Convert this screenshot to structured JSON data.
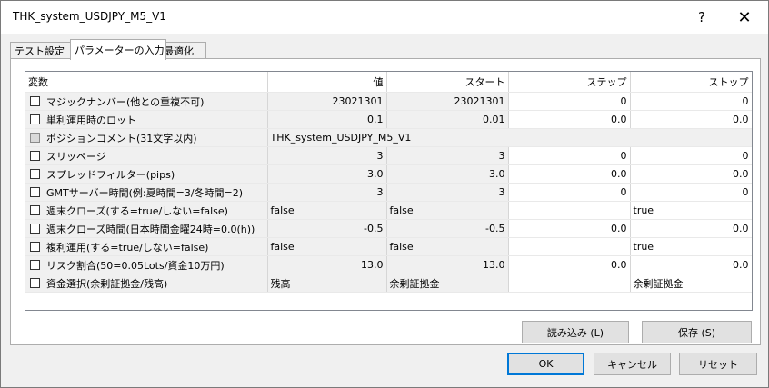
{
  "window": {
    "title": "THK_system_USDJPY_M5_V1",
    "help": "?",
    "close": "✕"
  },
  "tabs": [
    {
      "label": "テスト設定"
    },
    {
      "label": "パラメーターの入力"
    },
    {
      "label": "最適化"
    }
  ],
  "grid": {
    "headers": {
      "name": "変数",
      "value": "値",
      "start": "スタート",
      "step": "ステップ",
      "stop": "ストップ"
    },
    "rows": [
      {
        "name": "マジックナンバー(他との重複不可)",
        "value": "23021301",
        "start": "23021301",
        "step": "0",
        "stop": "0"
      },
      {
        "name": "単利運用時のロット",
        "value": "0.1",
        "start": "0.01",
        "step": "0.0",
        "stop": "0.0"
      },
      {
        "name": "ポジションコメント(31文字以内)",
        "value": "THK_system_USDJPY_M5_V1",
        "start": "",
        "step": "",
        "stop": ""
      },
      {
        "name": "スリッページ",
        "value": "3",
        "start": "3",
        "step": "0",
        "stop": "0"
      },
      {
        "name": "スプレッドフィルター(pips)",
        "value": "3.0",
        "start": "3.0",
        "step": "0.0",
        "stop": "0.0"
      },
      {
        "name": "GMTサーバー時間(例:夏時間=3/冬時間=2)",
        "value": "3",
        "start": "3",
        "step": "0",
        "stop": "0"
      },
      {
        "name": "週末クローズ(する=true/しない=false)",
        "value": "false",
        "start": "false",
        "step": "",
        "stop": "true"
      },
      {
        "name": "週末クローズ時間(日本時間金曜24時=0.0(h))",
        "value": "-0.5",
        "start": "-0.5",
        "step": "0.0",
        "stop": "0.0"
      },
      {
        "name": "複利運用(する=true/しない=false)",
        "value": "false",
        "start": "false",
        "step": "",
        "stop": "true"
      },
      {
        "name": "リスク割合(50=0.05Lots/資金10万円)",
        "value": "13.0",
        "start": "13.0",
        "step": "0.0",
        "stop": "0.0"
      },
      {
        "name": "資金選択(余剰証拠金/残高)",
        "value": "残高",
        "start": "余剰証拠金",
        "step": "",
        "stop": "余剰証拠金"
      }
    ]
  },
  "buttons": {
    "load": "読み込み (L)",
    "save": "保存 (S)",
    "ok": "OK",
    "cancel": "キャンセル",
    "reset": "リセット"
  }
}
